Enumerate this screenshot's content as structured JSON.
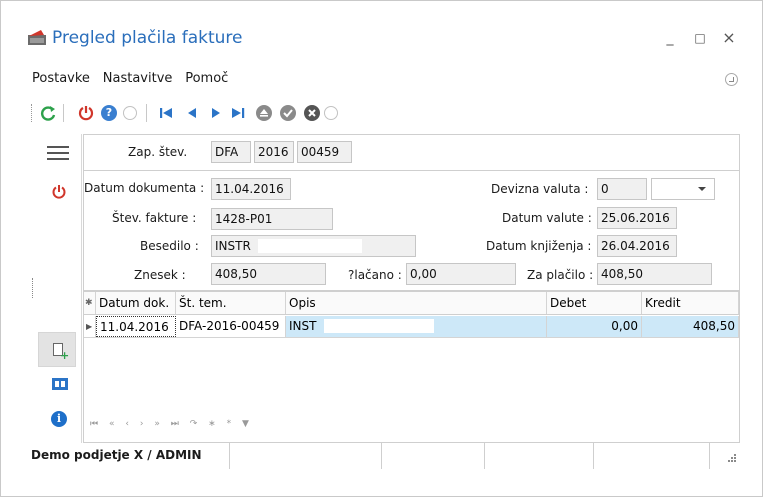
{
  "window": {
    "title": "Pregled plačila fakture",
    "minimize_glyph": "_",
    "maximize_glyph": "□",
    "close_glyph": "×"
  },
  "menu": {
    "items": [
      "Postavke",
      "Nastavitve",
      "Pomoč"
    ]
  },
  "toolbar": {
    "icons": [
      "refresh-icon",
      "power-icon",
      "help-icon",
      "goto-icon",
      "first-record-icon",
      "previous-record-icon",
      "next-record-icon",
      "last-record-icon",
      "up-icon",
      "confirm-icon",
      "cancel-icon",
      "collapse-icon"
    ]
  },
  "form": {
    "zap_stev_label": "Zap. štev.",
    "zap_stev_type": "DFA",
    "zap_stev_year": "2016",
    "zap_stev_number": "00459",
    "datum_dokumenta_label": "Datum dokumenta :",
    "datum_dokumenta": "11.04.2016",
    "stev_fakture_label": "Štev. fakture :",
    "stev_fakture": "1428-P01",
    "besedilo_label": "Besedilo :",
    "besedilo": "INSTR",
    "znesek_label": "Znesek :",
    "znesek": "408,50",
    "placano_label": "?lačano :",
    "placano": "0,00",
    "za_placilo_label": "Za plačilo :",
    "za_placilo": "408,50",
    "devizna_valuta_label": "Devizna valuta :",
    "devizna_valuta": "0",
    "devizna_valuta_select": "",
    "datum_valute_label": "Datum valute :",
    "datum_valute": "25.06.2016",
    "datum_knjizenja_label": "Datum knjiženja :",
    "datum_knjizenja": "26.04.2016"
  },
  "grid": {
    "columns": [
      "Datum dok.",
      "Št. tem.",
      "Opis",
      "Debet",
      "Kredit"
    ],
    "rows": [
      {
        "datum": "11.04.2016",
        "st_tem": "DFA-2016-00459",
        "opis": "INST",
        "debet": "0,00",
        "kredit": "408,50"
      }
    ],
    "nav_icons": [
      "⏮",
      "«",
      "‹",
      "›",
      "»",
      "⏭",
      "↷",
      "∗",
      "*",
      "▼"
    ]
  },
  "status": {
    "company_user": "Demo podjetje X / ADMIN"
  },
  "colors": {
    "title": "#2a6ebb",
    "selection": "#cde8f8",
    "accent_blue": "#2b74c7",
    "power_red": "#d0362b",
    "refresh_green": "#2da14b"
  }
}
